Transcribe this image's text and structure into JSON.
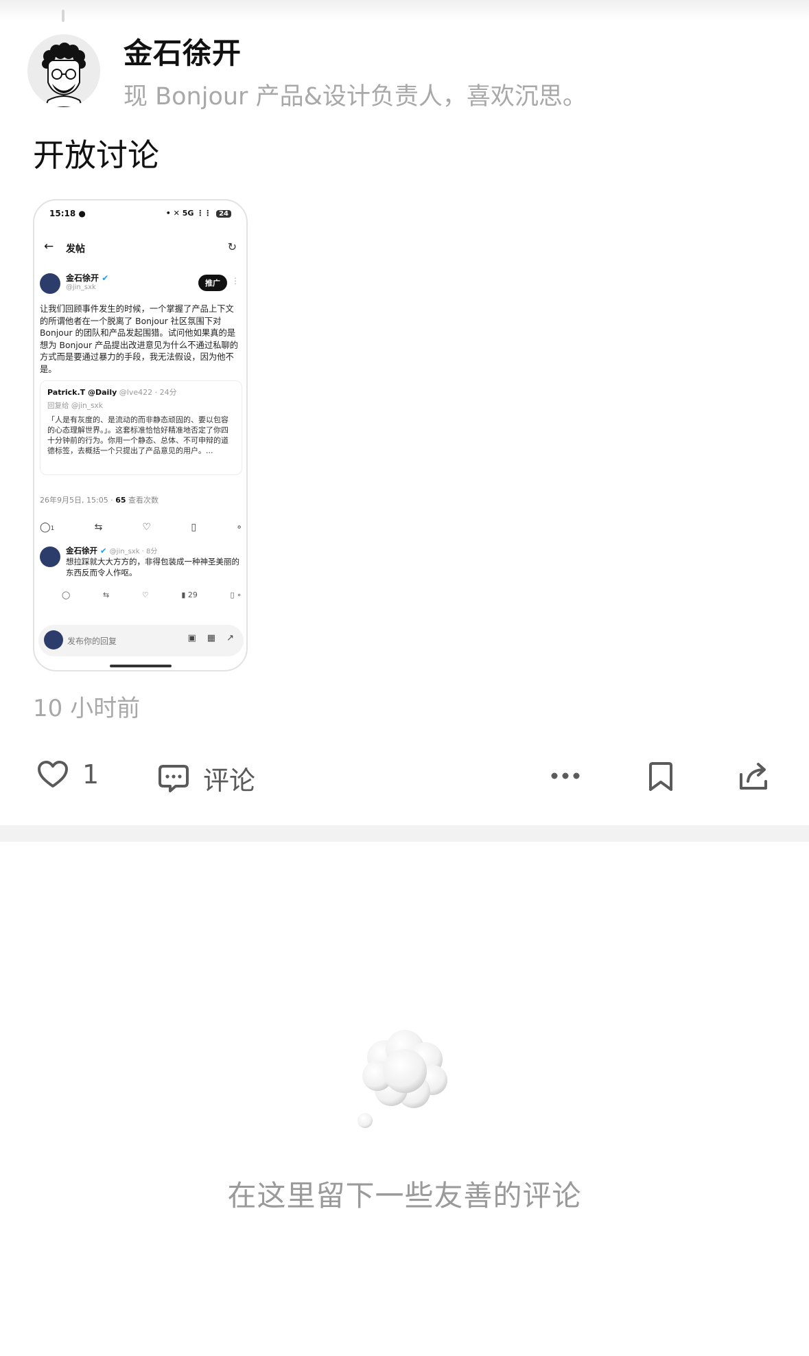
{
  "author": {
    "name": "金石徐开",
    "bio": "现 Bonjour 产品&设计负责人，喜欢沉思。"
  },
  "post": {
    "text": "开放讨论",
    "timestamp": "10 小时前"
  },
  "embedded_screenshot": {
    "status_time": "15:18",
    "status_network": "5G",
    "status_battery": "24",
    "page_title": "发帖",
    "author_name": "金石徐开",
    "author_handle": "@jin_sxk",
    "promote_label": "推广",
    "body": "让我们回顾事件发生的时候，一个掌握了产品上下文的所谓他者在一个脱离了 Bonjour 社区氛围下对 Bonjour 的团队和产品发起围猎。试问他如果真的是想为 Bonjour 产品提出改进意见为什么不通过私聊的方式而是要通过暴力的手段，我无法假设，因为他不是。",
    "quote_name": "Patrick.T @Daily",
    "quote_handle": "@lve422 · 24分",
    "quote_reply_to": "回复给 @jin_sxk",
    "quote_body": "「人是有灰度的、是流动的而非静态顽固的、要以包容的心态理解世界。」。这套标准恰恰好精准地否定了你四十分钟前的行为。你用一个静态、总体、不可申辩的道德标签，去概括一个只提出了产品意见的用户。...",
    "meta_date": "26年9月5日, 15:05 · ",
    "meta_views": "65",
    "meta_views_label": " 查看次数",
    "comment_count": "1",
    "reply_name": "金石徐开",
    "reply_handle": "@jin_sxk · 8分",
    "reply_body": "想拉踩就大大方方的，非得包装成一种神圣美丽的东西反而令人作呕。",
    "reply_views": "29",
    "compose_placeholder": "发布你的回复"
  },
  "actions": {
    "like_count": "1",
    "comment_label": "评论"
  },
  "empty_state": {
    "text": "在这里留下一些友善的评论"
  }
}
